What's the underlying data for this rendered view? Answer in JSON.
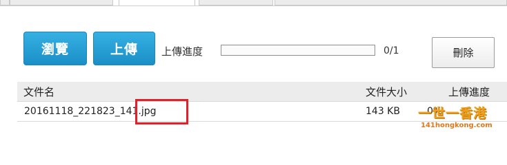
{
  "toolbar": {
    "browse_label": "瀏覽",
    "upload_label": "上傳",
    "progress_label": "上傳進度",
    "progress_fraction": 0,
    "progress_count": "0/1",
    "delete_label": "刪除"
  },
  "table": {
    "columns": [
      "文件名",
      "文件大小",
      "上傳進度"
    ],
    "rows": [
      {
        "name": "20161118_221823_141.jpg",
        "size": "143 KB",
        "progress": "0%"
      }
    ]
  },
  "colors": {
    "accent": "#1a8fc7",
    "highlight": "#e0212a",
    "watermark": "#f0a11c"
  },
  "watermark": {
    "brand": "一世一香港",
    "site": "141hongkong.com"
  }
}
